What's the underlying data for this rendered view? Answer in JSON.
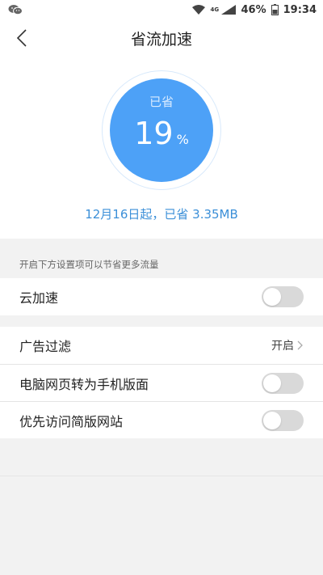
{
  "status_bar": {
    "net_type": "4G",
    "battery": "46%",
    "time": "19:34"
  },
  "nav": {
    "title": "省流加速"
  },
  "savings": {
    "label": "已省",
    "percent": "19",
    "unit": "%",
    "summary": "12月16日起，已省 3.35MB"
  },
  "hint": "开启下方设置项可以节省更多流量",
  "settings": {
    "cloud_accel": {
      "label": "云加速",
      "enabled": false
    },
    "ad_filter": {
      "label": "广告过滤",
      "value": "开启"
    },
    "desktop_to_mobile": {
      "label": "电脑网页转为手机版面",
      "enabled": false
    },
    "prefer_lite": {
      "label": "优先访问简版网站",
      "enabled": false
    }
  },
  "colors": {
    "accent": "#4da1f7",
    "summary_text": "#3b8fd8",
    "toggle_off": "#d9d9d9"
  }
}
